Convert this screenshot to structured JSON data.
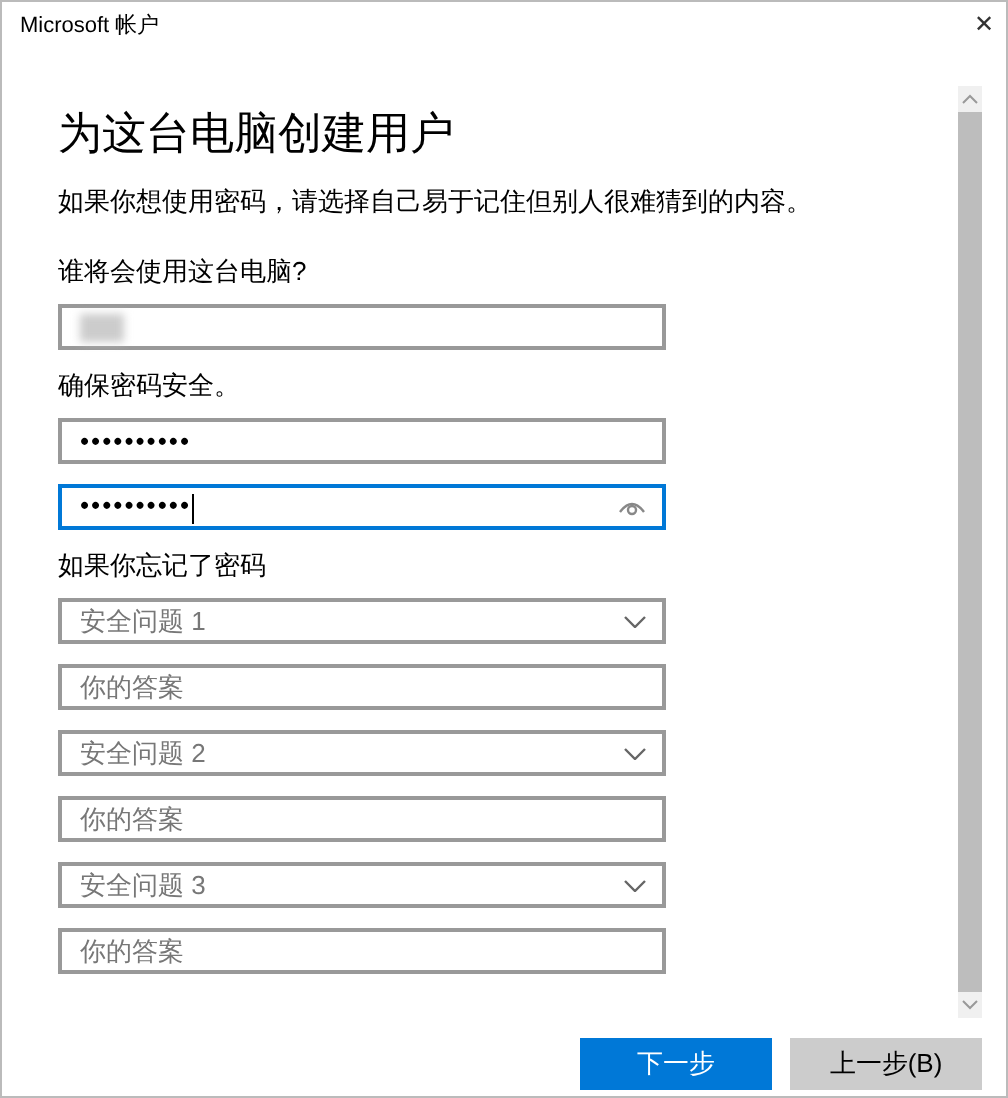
{
  "window": {
    "title": "Microsoft 帐户",
    "close": "✕"
  },
  "heading": "为这台电脑创建用户",
  "intro": "如果你想使用密码，请选择自己易于记住但别人很难猜到的内容。",
  "sections": [
    {
      "label": "谁将会使用这台电脑?",
      "fields": [
        {
          "kind": "redacted",
          "focused": false
        }
      ]
    },
    {
      "label": "确保密码安全。",
      "fields": [
        {
          "kind": "password",
          "value": "••••••••••",
          "focused": false
        },
        {
          "kind": "password",
          "value": "••••••••••",
          "focused": true,
          "reveal": true
        }
      ]
    },
    {
      "label": "如果你忘记了密码",
      "fields": [
        {
          "kind": "dropdown",
          "value": "安全问题 1",
          "focused": false
        },
        {
          "kind": "text",
          "placeholder": "你的答案",
          "focused": false
        },
        {
          "kind": "dropdown",
          "value": "安全问题 2",
          "focused": false
        },
        {
          "kind": "text",
          "placeholder": "你的答案",
          "focused": false
        },
        {
          "kind": "dropdown",
          "value": "安全问题 3",
          "focused": false
        },
        {
          "kind": "text",
          "placeholder": "你的答案",
          "focused": false
        }
      ]
    }
  ],
  "buttons": [
    {
      "label": "下一步",
      "primary": true
    },
    {
      "label": "上一步(B)",
      "primary": false
    }
  ]
}
